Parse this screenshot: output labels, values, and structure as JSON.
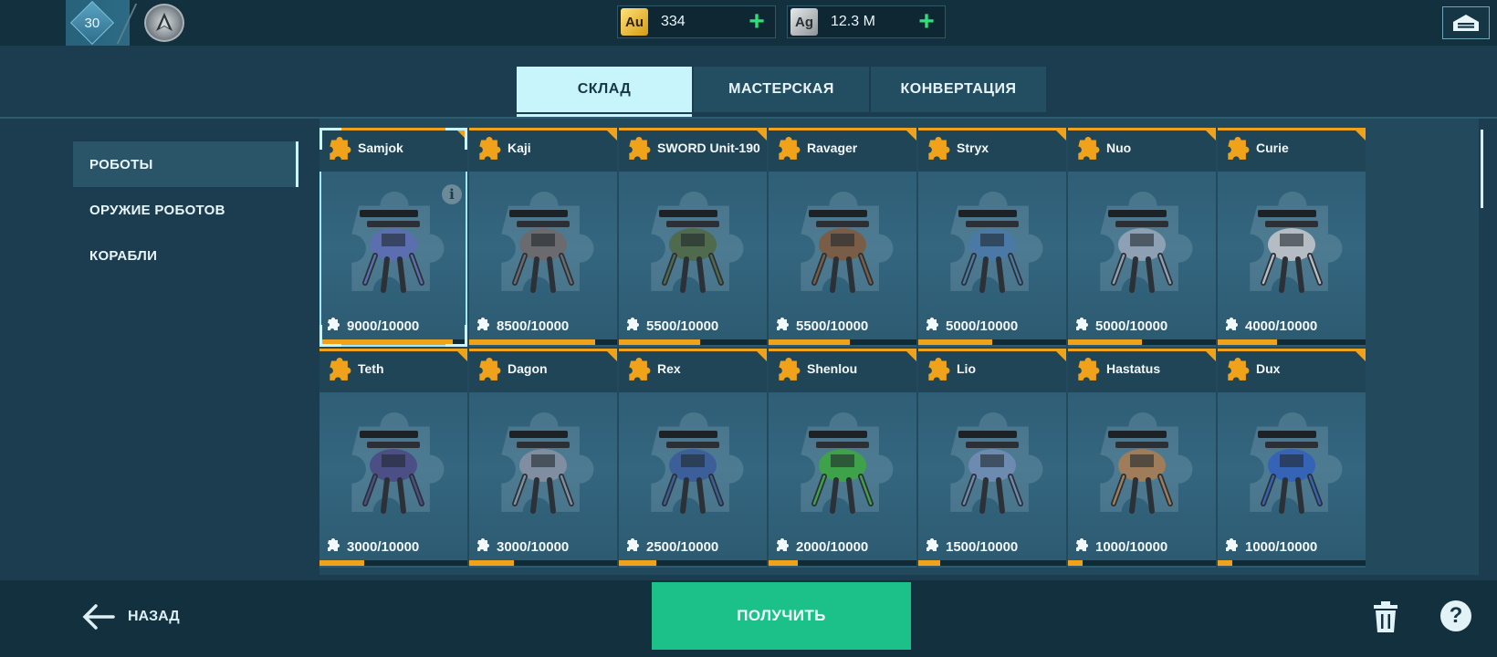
{
  "topbar": {
    "level": "30",
    "currencies": [
      {
        "code": "Au",
        "value": "334"
      },
      {
        "code": "Ag",
        "value": "12.3 M"
      }
    ],
    "plus_symbol": "+"
  },
  "tabs": [
    {
      "label": "СКЛАД",
      "active": true
    },
    {
      "label": "МАСТЕРСКАЯ",
      "active": false
    },
    {
      "label": "КОНВЕРТАЦИЯ",
      "active": false
    }
  ],
  "sidebar": {
    "items": [
      {
        "label": "РОБОТЫ",
        "active": true
      },
      {
        "label": "ОРУЖИЕ РОБОТОВ",
        "active": false
      },
      {
        "label": "КОРАБЛИ",
        "active": false
      }
    ]
  },
  "info_symbol": "i",
  "cards": [
    {
      "name": "Samjok",
      "count": "9000/10000",
      "progress": 0.9,
      "color": "#5b6fb0"
    },
    {
      "name": "Kaji",
      "count": "8500/10000",
      "progress": 0.85,
      "color": "#6b6a6e"
    },
    {
      "name": "SWORD Unit-190",
      "count": "5500/10000",
      "progress": 0.55,
      "color": "#4f6a4c"
    },
    {
      "name": "Ravager",
      "count": "5500/10000",
      "progress": 0.55,
      "color": "#7a5d46"
    },
    {
      "name": "Stryx",
      "count": "5000/10000",
      "progress": 0.5,
      "color": "#4a79a6"
    },
    {
      "name": "Nuo",
      "count": "5000/10000",
      "progress": 0.5,
      "color": "#8ea0b3"
    },
    {
      "name": "Curie",
      "count": "4000/10000",
      "progress": 0.4,
      "color": "#b5bcc4"
    },
    {
      "name": "Teth",
      "count": "3000/10000",
      "progress": 0.3,
      "color": "#4b4f86"
    },
    {
      "name": "Dagon",
      "count": "3000/10000",
      "progress": 0.3,
      "color": "#7f8fa1"
    },
    {
      "name": "Rex",
      "count": "2500/10000",
      "progress": 0.25,
      "color": "#3c5f9a"
    },
    {
      "name": "Shenlou",
      "count": "2000/10000",
      "progress": 0.2,
      "color": "#3ea24a"
    },
    {
      "name": "Lio",
      "count": "1500/10000",
      "progress": 0.15,
      "color": "#6d8ab0"
    },
    {
      "name": "Hastatus",
      "count": "1000/10000",
      "progress": 0.1,
      "color": "#a07d5a"
    },
    {
      "name": "Dux",
      "count": "1000/10000",
      "progress": 0.1,
      "color": "#3563b5"
    }
  ],
  "bottombar": {
    "back_label": "НАЗАД",
    "get_label": "ПОЛУЧИТЬ",
    "help_symbol": "?"
  }
}
